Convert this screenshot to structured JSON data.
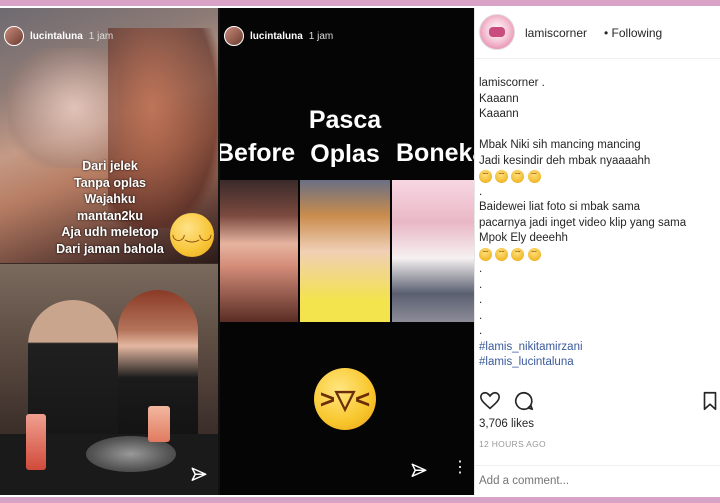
{
  "stories": [
    {
      "user": "lucintaluna",
      "time": "1 jam",
      "caption_lines": [
        "Dari jelek",
        "Tanpa oplas",
        "Wajahku",
        "mantan2ku",
        "Aja udh meletop",
        "Dari jaman bahola"
      ]
    },
    {
      "user": "lucintaluna",
      "time": "1 jam",
      "title_lines": [
        "Pasca",
        "Oplas"
      ],
      "label_before": "Before",
      "label_boneka": "Boneka"
    }
  ],
  "header": {
    "username": "lamiscorner",
    "follow_status": "• Following"
  },
  "caption": {
    "lines": [
      "lamiscorner .",
      "Kaaann",
      "Kaaann",
      "",
      "Mbak Niki sih mancing mancing",
      "Jadi kesindir deh mbak nyaaaahh",
      "EMOJI",
      ".",
      "Baidewei liat foto si mbak sama",
      "pacarnya jadi inget video klip yang sama",
      "Mpok Ely deeehh",
      "EMOJI",
      ".",
      ".",
      ".",
      ".",
      ".",
      "",
      "#lamis_nikitamirzani",
      "#lamis_lucintaluna"
    ]
  },
  "likes": "3,706 likes",
  "time_ago": "12 HOURS AGO",
  "comment_placeholder": "Add a comment...",
  "colors": {
    "stripe": "#d9a3c7",
    "hashtag": "#3a5a9b"
  }
}
